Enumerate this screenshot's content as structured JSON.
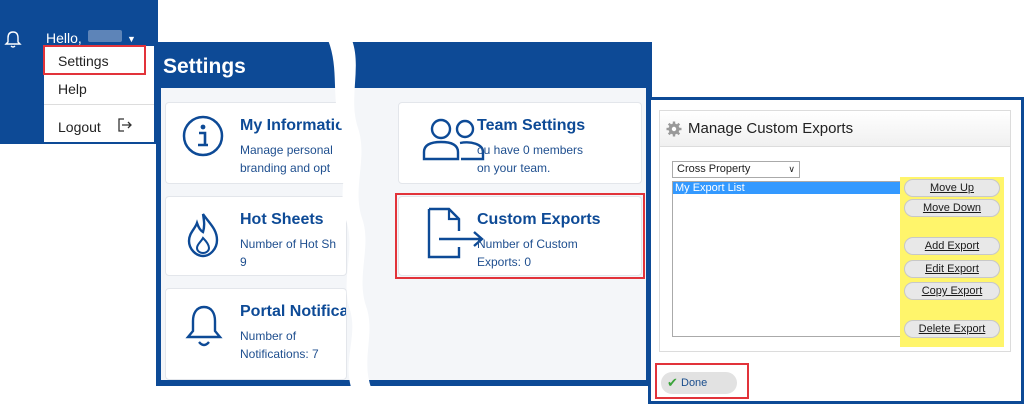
{
  "user_menu": {
    "greeting": "Hello,",
    "items": [
      {
        "label": "Settings",
        "icon": ""
      },
      {
        "label": "Help",
        "icon": ""
      },
      {
        "label": "Logout",
        "icon": "logout-icon"
      }
    ]
  },
  "settings": {
    "title": "Settings",
    "cards": [
      {
        "title": "My Information",
        "desc": [
          "Manage personal",
          "branding and opt"
        ],
        "icon": "info-icon"
      },
      {
        "title": "Hot Sheets",
        "desc": [
          "Number of Hot Sh",
          "9"
        ],
        "icon": "flame-icon"
      },
      {
        "title": "Portal Notificati",
        "desc": [
          "Number of",
          "Notifications: 7"
        ],
        "icon": "bell-icon"
      },
      {
        "title": "Team Settings",
        "desc": [
          "ou have 0 members",
          "on your team."
        ],
        "icon": "team-icon"
      },
      {
        "title": "Custom Exports",
        "desc": [
          "Number of Custom",
          "Exports: 0"
        ],
        "icon": "export-file-icon"
      }
    ]
  },
  "exports_dialog": {
    "title": "Manage Custom Exports",
    "select_value": "Cross Property",
    "list_items": [
      "My Export List"
    ],
    "buttons": {
      "move_up": "Move Up",
      "move_down": "Move Down",
      "add": "Add Export",
      "edit": "Edit Export",
      "copy": "Copy Export",
      "delete": "Delete Export"
    },
    "done": "Done"
  },
  "colors": {
    "brand_blue": "#0d4a96",
    "highlight_red": "#e2333a",
    "highlight_yellow": "#fff56b",
    "selection_blue": "#3399ff"
  }
}
